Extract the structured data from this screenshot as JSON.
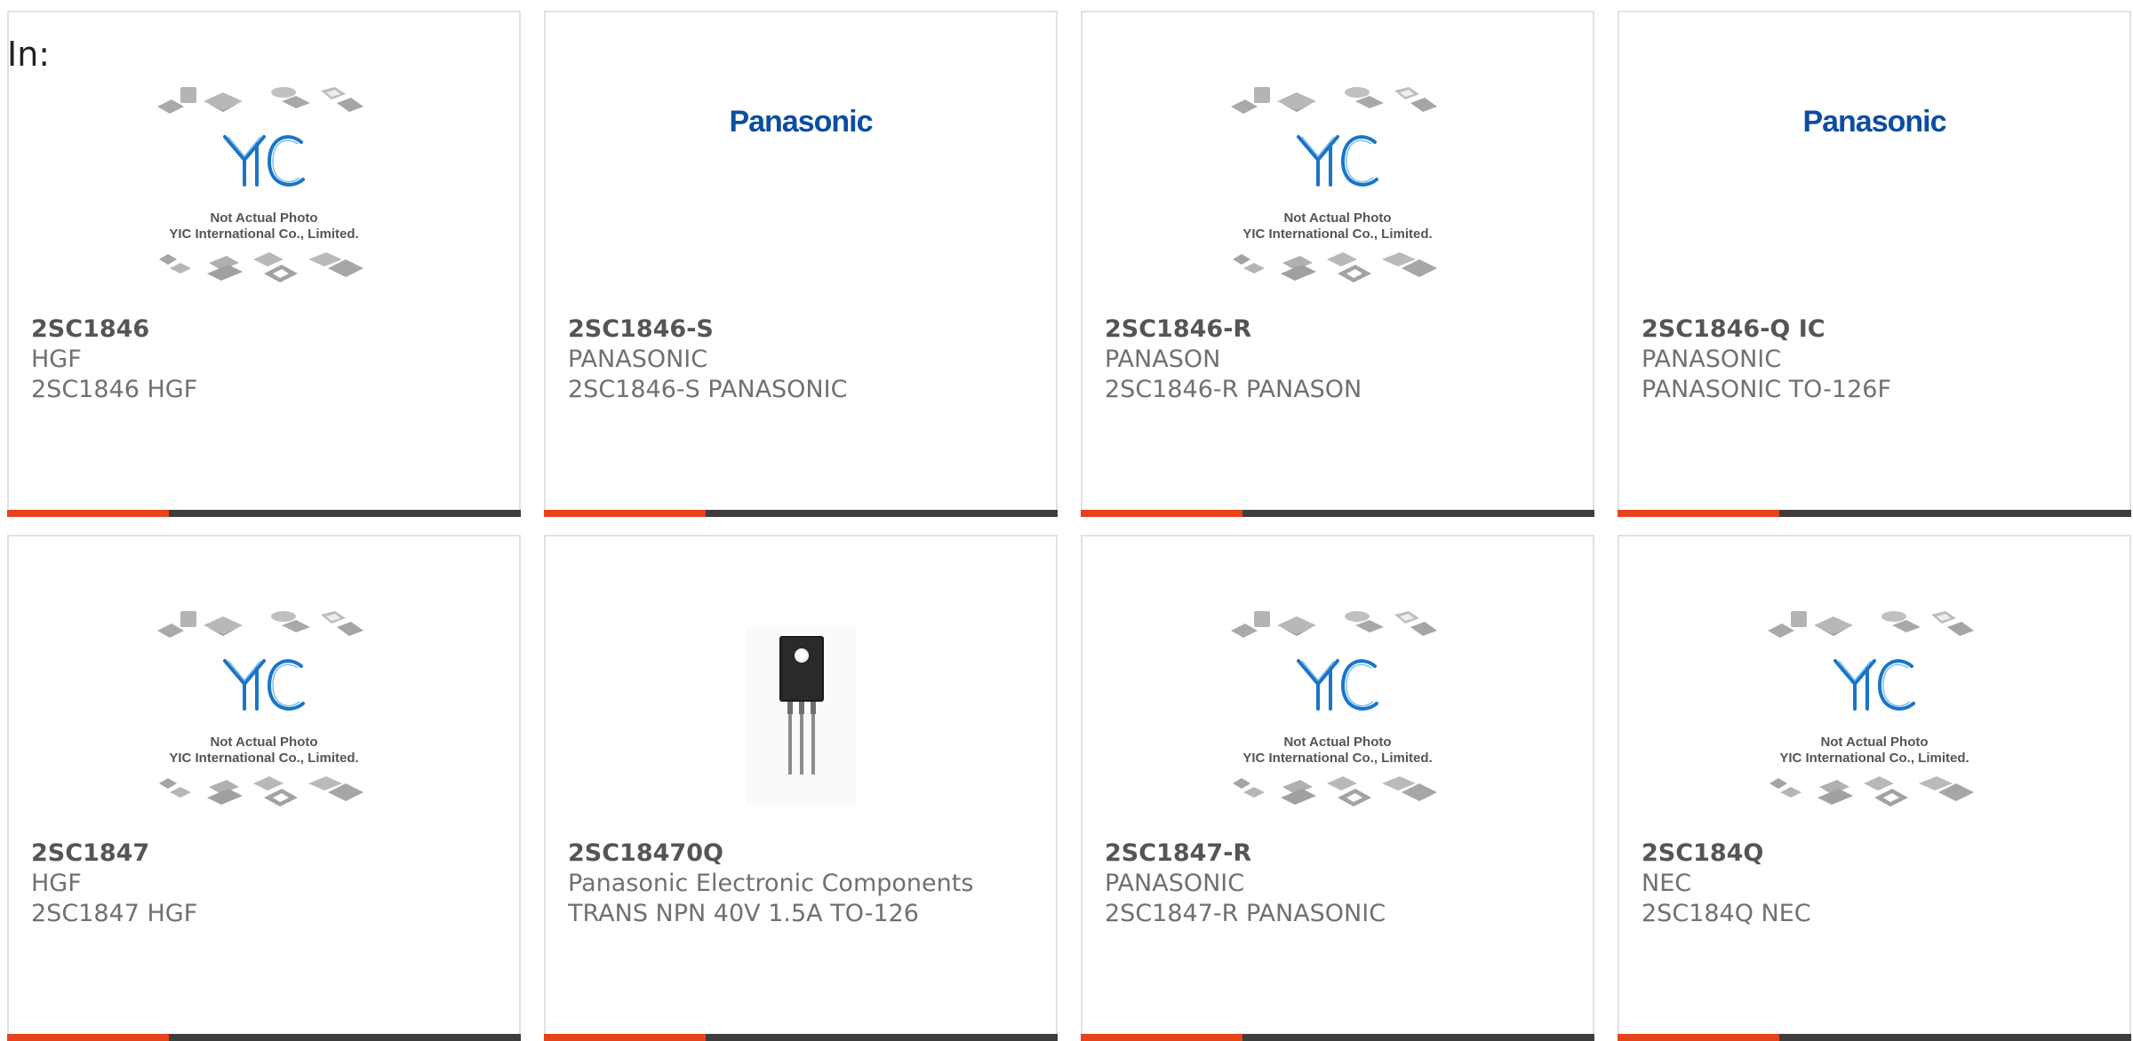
{
  "filter_label": "In:",
  "colors": {
    "accent": "#e8421a",
    "bar": "#3d3d3d",
    "border": "#e2e2e2",
    "brand_blue": "#0b4ea2"
  },
  "yic_placeholder": {
    "caption_line1": "Not Actual Photo",
    "caption_line2": "YIC International Co., Limited."
  },
  "products": [
    {
      "part_number": "2SC1846",
      "manufacturer": "HGF",
      "description": "2SC1846 HGF",
      "image": "yic-placeholder"
    },
    {
      "part_number": "2SC1846-S",
      "manufacturer": "PANASONIC",
      "description": "2SC1846-S PANASONIC",
      "image": "panasonic-logo",
      "logo_text": "Panasonic"
    },
    {
      "part_number": "2SC1846-R",
      "manufacturer": "PANASON",
      "description": "2SC1846-R PANASON",
      "image": "yic-placeholder"
    },
    {
      "part_number": "2SC1846-Q IC",
      "manufacturer": "PANASONIC",
      "description": "PANASONIC TO-126F",
      "image": "panasonic-logo",
      "logo_text": "Panasonic"
    },
    {
      "part_number": "2SC1847",
      "manufacturer": "HGF",
      "description": "2SC1847 HGF",
      "image": "yic-placeholder"
    },
    {
      "part_number": "2SC18470Q",
      "manufacturer": "Panasonic Electronic Components",
      "description": "TRANS NPN 40V 1.5A TO-126",
      "image": "transistor-photo"
    },
    {
      "part_number": "2SC1847-R",
      "manufacturer": "PANASONIC",
      "description": "2SC1847-R PANASONIC",
      "image": "yic-placeholder"
    },
    {
      "part_number": "2SC184Q",
      "manufacturer": "NEC",
      "description": "2SC184Q NEC",
      "image": "yic-placeholder"
    }
  ]
}
